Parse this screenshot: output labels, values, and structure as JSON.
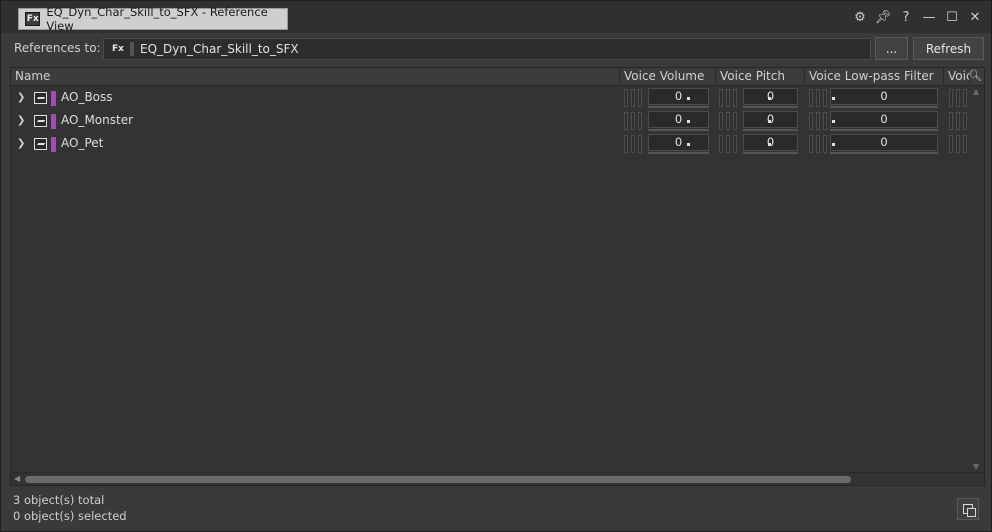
{
  "window": {
    "tab_icon": "Fx",
    "tab_title": "EQ_Dyn_Char_Skill_to_SFX - Reference View",
    "controls": [
      "gear-icon",
      "pin-icon",
      "help-icon",
      "minimize-icon",
      "maximize-icon",
      "close-icon"
    ]
  },
  "references": {
    "label": "References to:",
    "icon": "Fx",
    "value": "EQ_Dyn_Char_Skill_to_SFX",
    "browse_label": "...",
    "refresh_label": "Refresh"
  },
  "columns": {
    "name": "Name",
    "voice_volume": "Voice Volume",
    "voice_pitch": "Voice Pitch",
    "voice_lpf": "Voice Low-pass Filter",
    "voice_more": "Voic"
  },
  "rows": [
    {
      "name": "AO_Boss",
      "voice_volume": "0",
      "voice_pitch": "0",
      "voice_lpf": "0"
    },
    {
      "name": "AO_Monster",
      "voice_volume": "0",
      "voice_pitch": "0",
      "voice_lpf": "0"
    },
    {
      "name": "AO_Pet",
      "voice_volume": "0",
      "voice_pitch": "0",
      "voice_lpf": "0"
    }
  ],
  "status": {
    "total": "3 object(s) total",
    "selected": "0 object(s) selected"
  },
  "colors": {
    "row_color_bar": "#a24fb3",
    "background": "#3a3a3a"
  }
}
